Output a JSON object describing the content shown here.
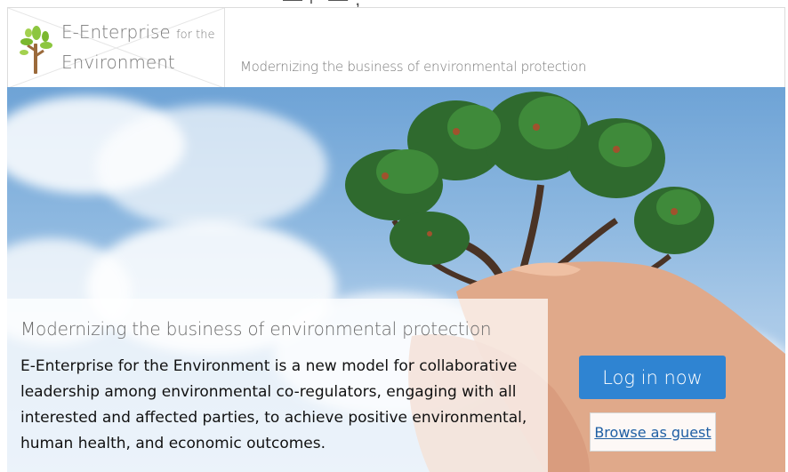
{
  "header": {
    "logo_line1": "E-Enterprise",
    "logo_line1_small": "for the",
    "logo_line2": "Environment",
    "tagline": "Modernizing the business of environmental protection"
  },
  "hero": {
    "title": "Modernizing the business of environmental protection",
    "body": "E-Enterprise for the Environment is a new model for collaborative leadership among environmental co-regulators, engaging with all interested and affected parties, to achieve positive environmental, human health, and economic outcomes.",
    "login_label": "Log in now",
    "guest_label": "Browse as guest"
  },
  "colors": {
    "accent": "#2f84d2",
    "link": "#1f5fa4",
    "logo_leaf": "#8cc63f",
    "logo_trunk": "#9b6a3b"
  },
  "icons": {
    "logo": "sapling-icon",
    "hero_image": "tree-in-hands-icon"
  }
}
